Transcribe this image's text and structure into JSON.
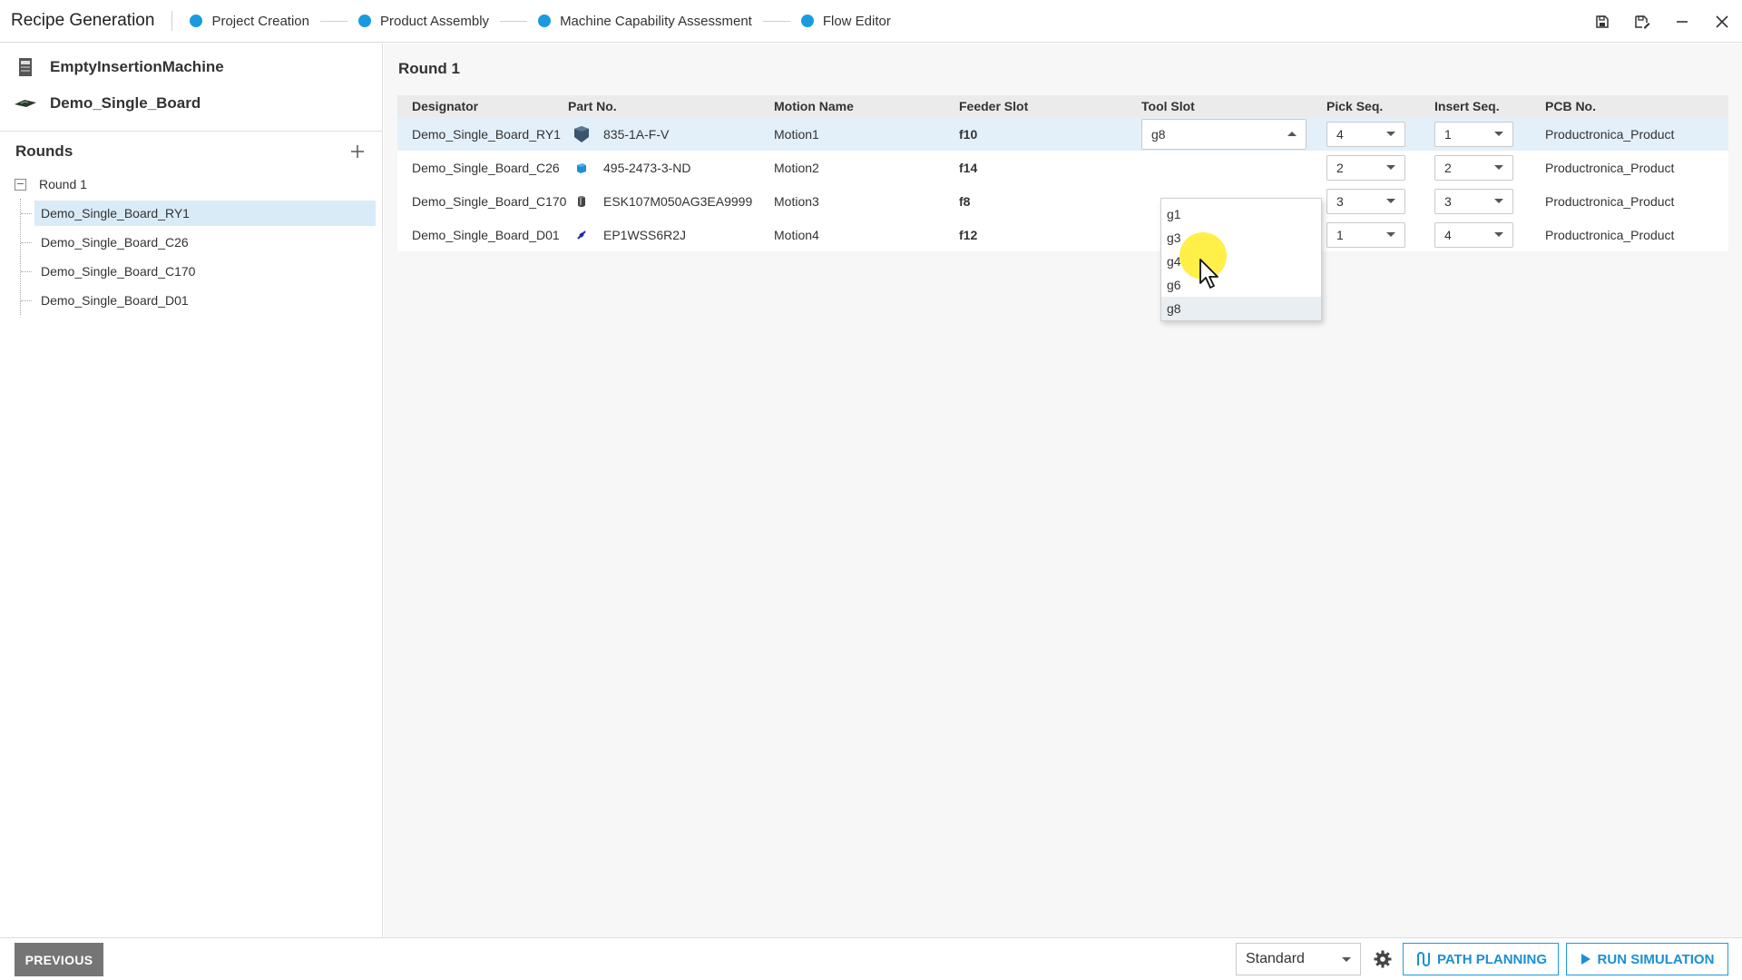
{
  "app": {
    "title": "Recipe Generation"
  },
  "steps": [
    {
      "label": "Project Creation"
    },
    {
      "label": "Product Assembly"
    },
    {
      "label": "Machine Capability Assessment"
    },
    {
      "label": "Flow Editor"
    }
  ],
  "window_icons": [
    "save-icon",
    "save-as-icon",
    "minimize-icon",
    "close-icon"
  ],
  "sidebar": {
    "machine": "EmptyInsertionMachine",
    "board": "Demo_Single_Board",
    "rounds_title": "Rounds",
    "tree": {
      "root": "Round 1",
      "items": [
        {
          "label": "Demo_Single_Board_RY1"
        },
        {
          "label": "Demo_Single_Board_C26"
        },
        {
          "label": "Demo_Single_Board_C170"
        },
        {
          "label": "Demo_Single_Board_D01"
        }
      ]
    }
  },
  "main": {
    "title": "Round 1",
    "columns": [
      "Designator",
      "Part No.",
      "Motion Name",
      "Feeder Slot",
      "Tool Slot",
      "Pick Seq.",
      "Insert Seq.",
      "PCB No."
    ],
    "rows": [
      {
        "designator": "Demo_Single_Board_RY1",
        "part_no": "835-1A-F-V",
        "motion": "Motion1",
        "feeder": "f10",
        "tool": "g8",
        "pick": "4",
        "insert": "1",
        "pcb": "Productronica_Product"
      },
      {
        "designator": "Demo_Single_Board_C26",
        "part_no": "495-2473-3-ND",
        "motion": "Motion2",
        "feeder": "f14",
        "tool": "",
        "pick": "2",
        "insert": "2",
        "pcb": "Productronica_Product"
      },
      {
        "designator": "Demo_Single_Board_C170",
        "part_no": "ESK107M050AG3EA9999",
        "motion": "Motion3",
        "feeder": "f8",
        "tool": "",
        "pick": "3",
        "insert": "3",
        "pcb": "Productronica_Product"
      },
      {
        "designator": "Demo_Single_Board_D01",
        "part_no": "EP1WSS6R2J",
        "motion": "Motion4",
        "feeder": "f12",
        "tool": "",
        "pick": "1",
        "insert": "4",
        "pcb": "Productronica_Product"
      }
    ],
    "tool_dropdown": {
      "options": [
        "g1",
        "g3",
        "g4",
        "g6",
        "g8"
      ],
      "hovered": "g8"
    }
  },
  "bottom": {
    "previous_label": "PREVIOUS",
    "mode": "Standard",
    "path_planning_label": "PATH PLANNING",
    "run_simulation_label": "RUN SIMULATION"
  },
  "colors": {
    "accent": "#1a9be0",
    "selected_row": "#d9ebf7",
    "active_row": "#e3f0f9"
  }
}
